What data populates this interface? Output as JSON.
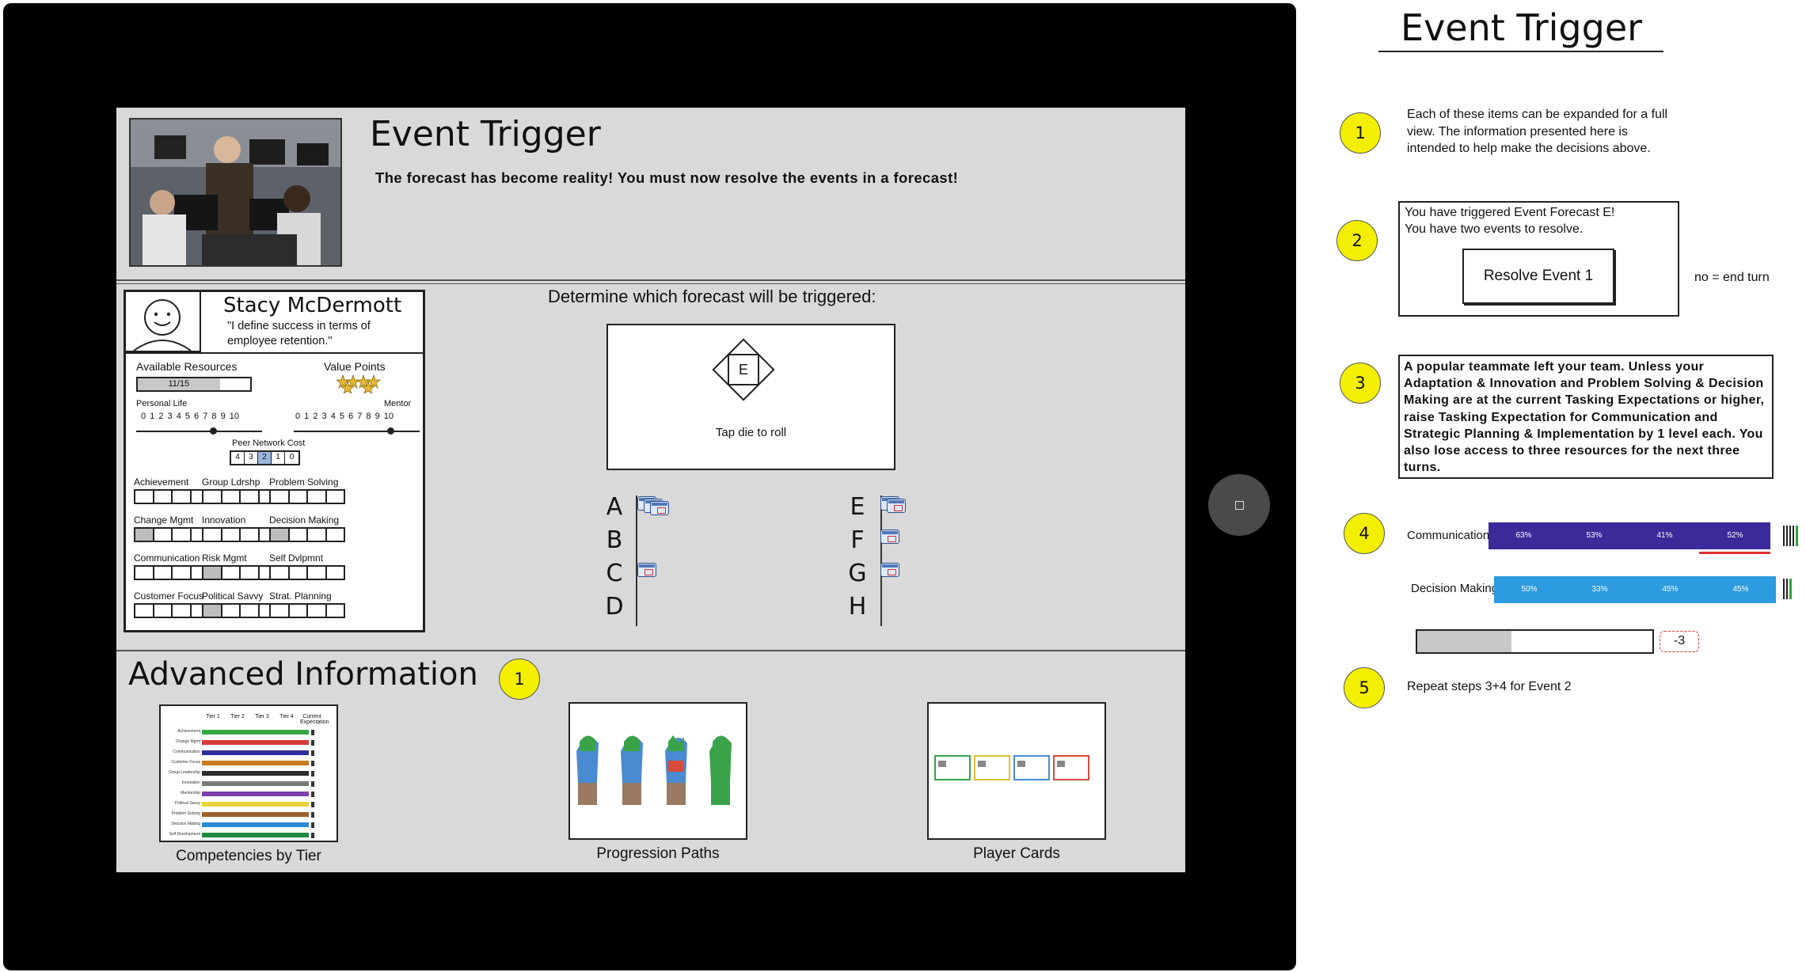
{
  "screen": {
    "header": {
      "title": "Event Trigger",
      "subtitle": "The forecast has become reality! You must now resolve the events in a forecast!"
    },
    "player": {
      "name": "Stacy McDermott",
      "quote": "\"I define success in terms of employee retention.\"",
      "available_resources_label": "Available Resources",
      "resources_value": "11/15",
      "resources_fraction": 0.73,
      "value_points_label": "Value Points",
      "personal_life_label": "Personal Life",
      "mentor_label": "Mentor",
      "scale": [
        "0",
        "1",
        "2",
        "3",
        "4",
        "5",
        "6",
        "7",
        "8",
        "9",
        "10"
      ],
      "peer_network_label": "Peer Network Cost",
      "peer_values": [
        "4",
        "3",
        "2",
        "1",
        "0"
      ],
      "peer_selected": "2",
      "competencies": [
        {
          "label": "Achievement",
          "filled": 0
        },
        {
          "label": "Group Ldrshp",
          "filled": 0
        },
        {
          "label": "Problem Solving",
          "filled": 0
        },
        {
          "label": "Change Mgmt",
          "filled": 1
        },
        {
          "label": "Innovation",
          "filled": 0
        },
        {
          "label": "Decision Making",
          "filled": 1
        },
        {
          "label": "Communication",
          "filled": 0
        },
        {
          "label": "Risk Mgmt",
          "filled": 1
        },
        {
          "label": "Self Dvlpmnt",
          "filled": 0
        },
        {
          "label": "Customer Focus",
          "filled": 0
        },
        {
          "label": "Political Savvy",
          "filled": 1
        },
        {
          "label": "Strat. Planning",
          "filled": 0
        }
      ]
    },
    "forecast": {
      "prompt": "Determine which forecast will be triggered:",
      "die_label": "E",
      "tap_label": "Tap die to roll",
      "left_letters": [
        "A",
        "B",
        "C",
        "D"
      ],
      "right_letters": [
        "E",
        "F",
        "G",
        "H"
      ],
      "card_counts": {
        "A": 3,
        "B": 0,
        "C": 1,
        "D": 0,
        "E": 2,
        "F": 1,
        "G": 1,
        "H": 0
      }
    },
    "advanced": {
      "title": "Advanced Information",
      "badge": "1",
      "thumbs": [
        {
          "caption": "Competencies by Tier"
        },
        {
          "caption": "Progression Paths"
        },
        {
          "caption": "Player Cards"
        }
      ],
      "tier_headers": [
        "Tier 1",
        "Tier 2",
        "Tier 3",
        "Tier 4",
        "Current Expectation"
      ],
      "tier_rows": [
        "Achievement",
        "Change Mgmt",
        "Communication",
        "Customer Focus",
        "Group Leadership",
        "Innovation",
        "Mentorship",
        "Political Savvy",
        "Problem Solving",
        "Decision Making",
        "Self Development"
      ],
      "tier_colors": [
        "#35a844",
        "#d63b3b",
        "#2e2e9a",
        "#c87a1e",
        "#2d2d2d",
        "#7a7a7a",
        "#7f3fa8",
        "#e8d33a",
        "#9b5f2e",
        "#2b8ad6",
        "#1c8a3c"
      ]
    }
  },
  "notes": {
    "title": "Event Trigger",
    "steps": [
      {
        "num": "1",
        "text": "Each of these items can be expanded for a full view. The information presented here is intended to help make the decisions above."
      },
      {
        "num": "2",
        "box_text_1": "You have triggered Event Forecast E!",
        "box_text_2": "You have two events to resolve.",
        "button": "Resolve Event 1",
        "aside": "no = end turn"
      },
      {
        "num": "3",
        "text": "A popular teammate left your team. Unless your Adaptation & Innovation and Problem Solving & Decision Making are at the current Tasking Expectations or higher, raise Tasking Expectation for Communication and Strategic Planning & Implementation by 1 level each. You also lose access to three resources for the next three turns."
      },
      {
        "num": "4",
        "bars": [
          {
            "label": "Communication",
            "values": [
              "63%",
              "53%",
              "41%",
              "52%"
            ],
            "color": "#3b2a9a"
          },
          {
            "label": "Decision Making",
            "values": [
              "50%",
              "33%",
              "45%",
              "45%"
            ],
            "color": "#2c9be0"
          }
        ],
        "penalty": "-3",
        "penalty_fraction": 0.4
      },
      {
        "num": "5",
        "text": "Repeat steps 3+4 for Event 2"
      }
    ]
  }
}
